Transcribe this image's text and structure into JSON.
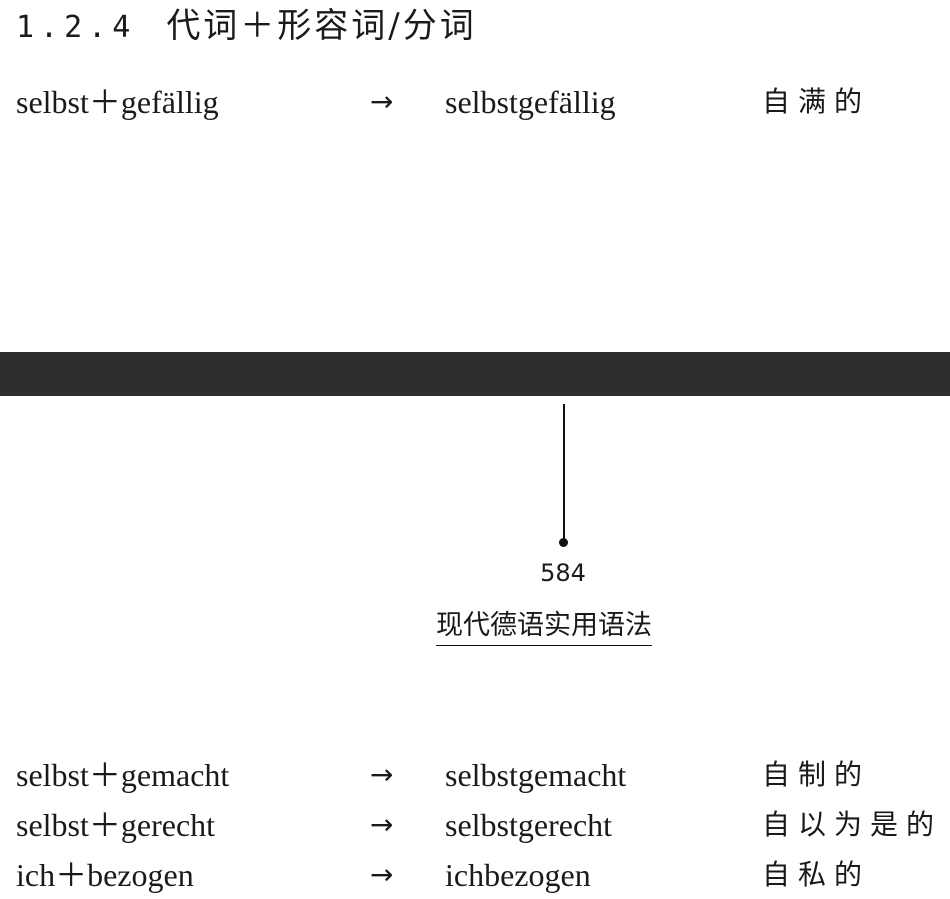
{
  "section": {
    "number": "1.2.4",
    "title": "代词＋形容词/分词"
  },
  "entries": [
    {
      "compound": "selbst＋gefällig",
      "arrow": "→",
      "result": "selbstgefällig",
      "meaning": "自满的"
    },
    {
      "compound": "selbst＋gemacht",
      "arrow": "→",
      "result": "selbstgemacht",
      "meaning": "自制的"
    },
    {
      "compound": "selbst＋gerecht",
      "arrow": "→",
      "result": "selbstgerecht",
      "meaning": "自以为是的"
    },
    {
      "compound": "ich＋bezogen",
      "arrow": "→",
      "result": "ichbezogen",
      "meaning": "自私的"
    }
  ],
  "footer": {
    "page_number": "584",
    "book_title": "现代德语实用语法"
  },
  "colors": {
    "divider_bar": "#2e2e2e",
    "text": "#1a1a1a"
  }
}
